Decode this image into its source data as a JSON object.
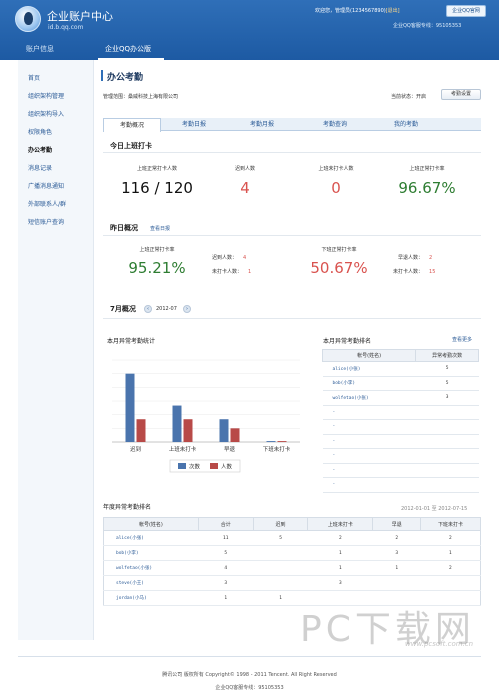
{
  "header": {
    "title": "企业账户中心",
    "subtitle": "id.b.qq.com",
    "welcome_prefix": "欢迎您，",
    "username": "管理员(1234567890)",
    "logout": "[退出]",
    "official_site": "企业QQ官网",
    "hotline": "企业QQ客服专线：95105353"
  },
  "nav": {
    "items": [
      {
        "label": "账户信息"
      },
      {
        "label": "企业QQ办公版"
      }
    ]
  },
  "sidebar": {
    "items": [
      {
        "label": "首页"
      },
      {
        "label": "组织架构管理"
      },
      {
        "label": "组织架构导入"
      },
      {
        "label": "权限角色"
      },
      {
        "label": "办公考勤"
      },
      {
        "label": "消息记录"
      },
      {
        "label": "广播消息通知"
      },
      {
        "label": "外部联系人/群"
      },
      {
        "label": "短信账户查询"
      }
    ]
  },
  "page": {
    "title": "办公考勤",
    "scope": "管理范围：桑威科技上海有限公司",
    "status": "当前状态：开启",
    "settings_button": "考勤设置"
  },
  "tabs": [
    {
      "label": "考勤概况"
    },
    {
      "label": "考勤日报"
    },
    {
      "label": "考勤月报"
    },
    {
      "label": "考勤查询"
    },
    {
      "label": "我的考勤"
    }
  ],
  "today": {
    "title": "今日上班打卡",
    "kpis": [
      {
        "label": "上班正常打卡人数",
        "value": "116 / 120"
      },
      {
        "label": "迟到人数",
        "value": "4"
      },
      {
        "label": "上班未打卡人数",
        "value": "0"
      },
      {
        "label": "上班正常打卡率",
        "value": "96.67%"
      }
    ]
  },
  "yesterday": {
    "title": "昨日概况",
    "link": "查看日报",
    "on_rate_label": "上班正常打卡率",
    "on_rate": "95.21%",
    "late_label": "迟到人数：",
    "late": "4",
    "on_missing_label": "未打卡人数：",
    "on_missing": "1",
    "off_rate_label": "下班正常打卡率",
    "off_rate": "50.67%",
    "early_label": "早退人数：",
    "early": "2",
    "off_missing_label": "未打卡人数：",
    "off_missing": "15"
  },
  "month": {
    "title": "7月概况",
    "current": "2012-07",
    "prev_icon": "‹",
    "next_icon": "›"
  },
  "chart_data": {
    "type": "bar",
    "title": "本月异常考勤统计",
    "categories": [
      "迟到",
      "上班未打卡",
      "早退",
      "下班未打卡"
    ],
    "series": [
      {
        "name": "次数",
        "values": [
          15,
          8,
          5,
          0.2
        ],
        "color": "#4a74ad"
      },
      {
        "name": "人数",
        "values": [
          5,
          5,
          3,
          0.2
        ],
        "color": "#b84a48"
      }
    ],
    "ylim": [
      0,
      18
    ],
    "grid": true,
    "legend": "bottom"
  },
  "rank": {
    "title": "本月异常考勤排名",
    "more": "查看更多",
    "columns": [
      "帐号(姓名)",
      "异常考勤次数"
    ],
    "rows": [
      [
        "alice(小张)",
        "5"
      ],
      [
        "bob(小李)",
        "5"
      ],
      [
        "wolfetao(小张)",
        "3"
      ],
      [
        "-",
        ""
      ],
      [
        "-",
        ""
      ],
      [
        "-",
        ""
      ],
      [
        "-",
        ""
      ],
      [
        "-",
        ""
      ],
      [
        "-",
        ""
      ]
    ]
  },
  "annual": {
    "title": "年度异常考勤排名",
    "date_range": "2012-01-01 至 2012-07-15",
    "columns": [
      "帐号(姓名)",
      "合计",
      "迟到",
      "上班未打卡",
      "早退",
      "下班未打卡"
    ],
    "rows": [
      [
        "alice(小张)",
        "11",
        "5",
        "2",
        "2",
        "2"
      ],
      [
        "bob(小李)",
        "5",
        "",
        "1",
        "3",
        "1"
      ],
      [
        "wolfetao(小张)",
        "4",
        "",
        "1",
        "1",
        "2"
      ],
      [
        "steve(小王)",
        "3",
        "",
        "3",
        "",
        ""
      ],
      [
        "jordan(小马)",
        "1",
        "1",
        "",
        "",
        ""
      ]
    ]
  },
  "footer": {
    "line1": "腾讯公司 版权所有   Copyright© 1998 - 2011 Tencent. All Right Reserved",
    "line2": "企业QQ客服专线：95105353"
  },
  "watermark": {
    "text": "PC下载网",
    "url": "www.pcsoft.com.cn"
  }
}
